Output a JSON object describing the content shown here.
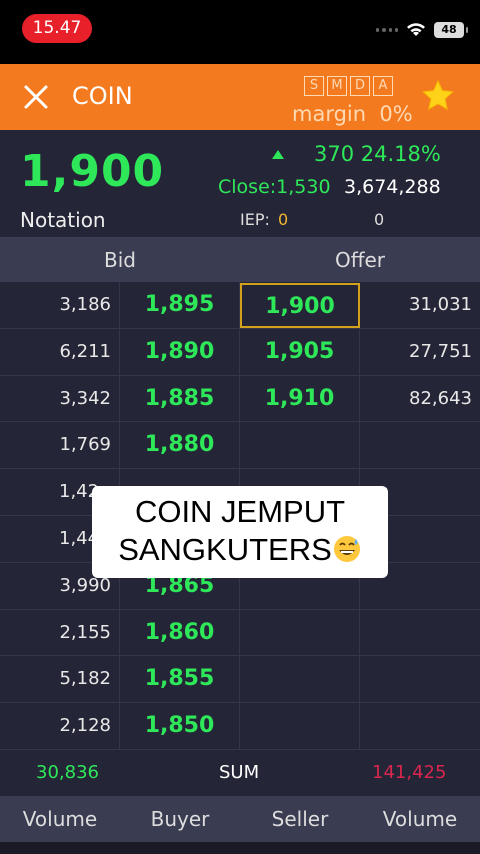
{
  "status_bar": {
    "time": "15.47",
    "battery": "48"
  },
  "header": {
    "ticker": "COIN",
    "badges": [
      "S",
      "M",
      "D",
      "A"
    ],
    "margin_label": "margin  0%"
  },
  "summary": {
    "last_price": "1,900",
    "notation": "Notation",
    "change": "370 24.18%",
    "close_label": "Close:1,530",
    "volume": "3,674,288",
    "iep_label": "IEP:",
    "iep_value": "0",
    "iep_value2": "0"
  },
  "book_header": {
    "bid": "Bid",
    "offer": "Offer"
  },
  "order_book": [
    {
      "bid_vol": "3,186",
      "bid_price": "1,895",
      "offer_price": "1,900",
      "offer_vol": "31,031"
    },
    {
      "bid_vol": "6,211",
      "bid_price": "1,890",
      "offer_price": "1,905",
      "offer_vol": "27,751"
    },
    {
      "bid_vol": "3,342",
      "bid_price": "1,885",
      "offer_price": "1,910",
      "offer_vol": "82,643"
    },
    {
      "bid_vol": "1,769",
      "bid_price": "1,880",
      "offer_price": "",
      "offer_vol": ""
    },
    {
      "bid_vol": "1,42",
      "bid_price": "",
      "offer_price": "",
      "offer_vol": ""
    },
    {
      "bid_vol": "1,44",
      "bid_price": "",
      "offer_price": "",
      "offer_vol": ""
    },
    {
      "bid_vol": "3,990",
      "bid_price": "1,865",
      "offer_price": "",
      "offer_vol": ""
    },
    {
      "bid_vol": "2,155",
      "bid_price": "1,860",
      "offer_price": "",
      "offer_vol": ""
    },
    {
      "bid_vol": "5,182",
      "bid_price": "1,855",
      "offer_price": "",
      "offer_vol": ""
    },
    {
      "bid_vol": "2,128",
      "bid_price": "1,850",
      "offer_price": "",
      "offer_vol": ""
    }
  ],
  "overlay": {
    "line1": "COIN JEMPUT",
    "line2": "SANGKUTERS"
  },
  "sum": {
    "bid_total": "30,836",
    "label": "SUM",
    "offer_total": "141,425"
  },
  "trade_header": {
    "volume_left": "Volume",
    "buyer": "Buyer",
    "seller": "Seller",
    "volume_right": "Volume"
  },
  "colors": {
    "accent": "#f47a20",
    "up": "#2ee85a",
    "down": "#d8264f",
    "highlight": "#d4a21a"
  },
  "icons": {
    "close": "close-icon",
    "star": "star-icon",
    "wifi": "wifi-icon",
    "emoji": "grinning-sweat-emoji-icon"
  }
}
